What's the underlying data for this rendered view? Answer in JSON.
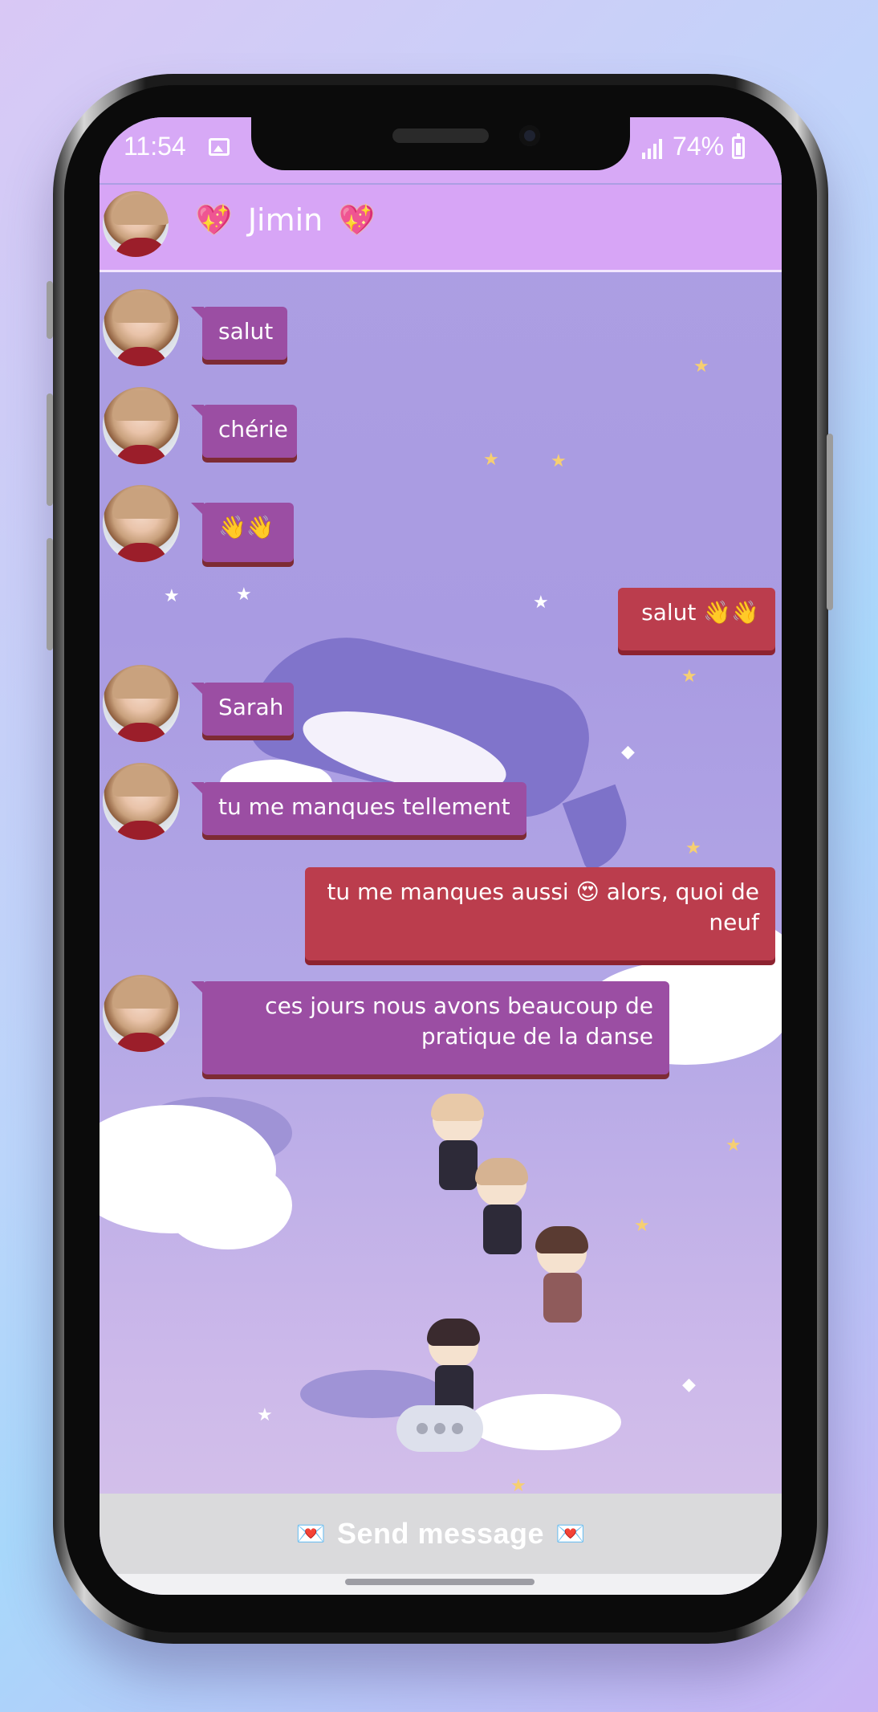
{
  "status_bar": {
    "time": "11:54",
    "battery": "74%"
  },
  "header": {
    "name": "Jimin",
    "heart_emoji": "💖"
  },
  "messages": [
    {
      "side": "in",
      "text": "salut"
    },
    {
      "side": "in",
      "text": "chérie"
    },
    {
      "side": "in",
      "text": "👋👋"
    },
    {
      "side": "out",
      "text": "salut 👋👋"
    },
    {
      "side": "in",
      "text": "Sarah"
    },
    {
      "side": "in",
      "text": "tu me manques tellement"
    },
    {
      "side": "out",
      "text": "tu me manques aussi 😍 alors, quoi de neuf"
    },
    {
      "side": "in",
      "text": "ces jours nous avons beaucoup de pratique de la danse"
    }
  ],
  "input": {
    "label": "Send message",
    "envelope_emoji": "💌"
  },
  "colors": {
    "header_bg": "#d7a5f6",
    "incoming_bubble": "#9b4ea3",
    "outgoing_bubble": "#bb3d4d",
    "input_bar": "#dadadc"
  }
}
